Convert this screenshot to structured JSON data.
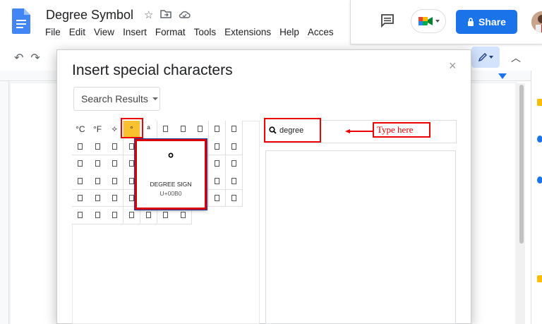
{
  "document": {
    "title": "Degree Symbol",
    "menu": [
      "File",
      "Edit",
      "View",
      "Insert",
      "Format",
      "Tools",
      "Extensions",
      "Help",
      "Acces"
    ]
  },
  "header": {
    "share_label": "Share",
    "share_color": "#1a73e8"
  },
  "dialog": {
    "title": "Insert special characters",
    "close_glyph": "×",
    "category": "Search Results",
    "search_value": "degree",
    "grid_rows": [
      [
        "°C",
        "°F",
        "⟡",
        "°",
        "ª",
        "",
        "",
        "",
        "",
        ""
      ],
      [
        "",
        "",
        "",
        "",
        "",
        "",
        "",
        "",
        "",
        ""
      ],
      [
        "",
        "",
        "",
        "",
        "",
        "",
        "",
        "",
        "",
        ""
      ],
      [
        "",
        "",
        "",
        "",
        "",
        "",
        "",
        "",
        "",
        ""
      ],
      [
        "",
        "",
        "",
        "",
        "",
        "",
        "",
        "",
        "",
        ""
      ],
      [
        "",
        "",
        "",
        "",
        "",
        "",
        ""
      ]
    ],
    "highlight_color": "#f9c12d",
    "preview": {
      "glyph": "°",
      "name": "DEGREE SIGN",
      "code": "U+00B0"
    }
  },
  "annotation": {
    "label": "Type here",
    "color": "#e00000"
  }
}
